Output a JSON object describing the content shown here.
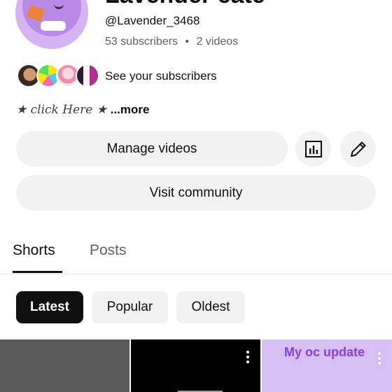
{
  "channel": {
    "name": "Lavender cate",
    "handle": "@Lavender_3468",
    "subscribers": "53 subscribers",
    "separator": "•",
    "videos": "2 videos",
    "see_subscribers": "See your subscribers",
    "description": "★ click Here ★",
    "more": "...more"
  },
  "buttons": {
    "manage_videos": "Manage videos",
    "visit_community": "Visit community",
    "analytics_icon": "analytics-icon",
    "edit_icon": "pencil-icon"
  },
  "tabs": [
    {
      "label": "Shorts",
      "active": true
    },
    {
      "label": "Posts",
      "active": false
    }
  ],
  "filters": [
    {
      "label": "Latest",
      "selected": true
    },
    {
      "label": "Popular",
      "selected": false
    },
    {
      "label": "Oldest",
      "selected": false
    }
  ],
  "shorts": [
    {
      "title": ""
    },
    {
      "title": ""
    },
    {
      "title": "My oc update"
    }
  ],
  "colors": {
    "accent_title": "#8a3de0",
    "chip_selected": "#0f0f0f",
    "pill_bg": "#f2f2f2"
  }
}
